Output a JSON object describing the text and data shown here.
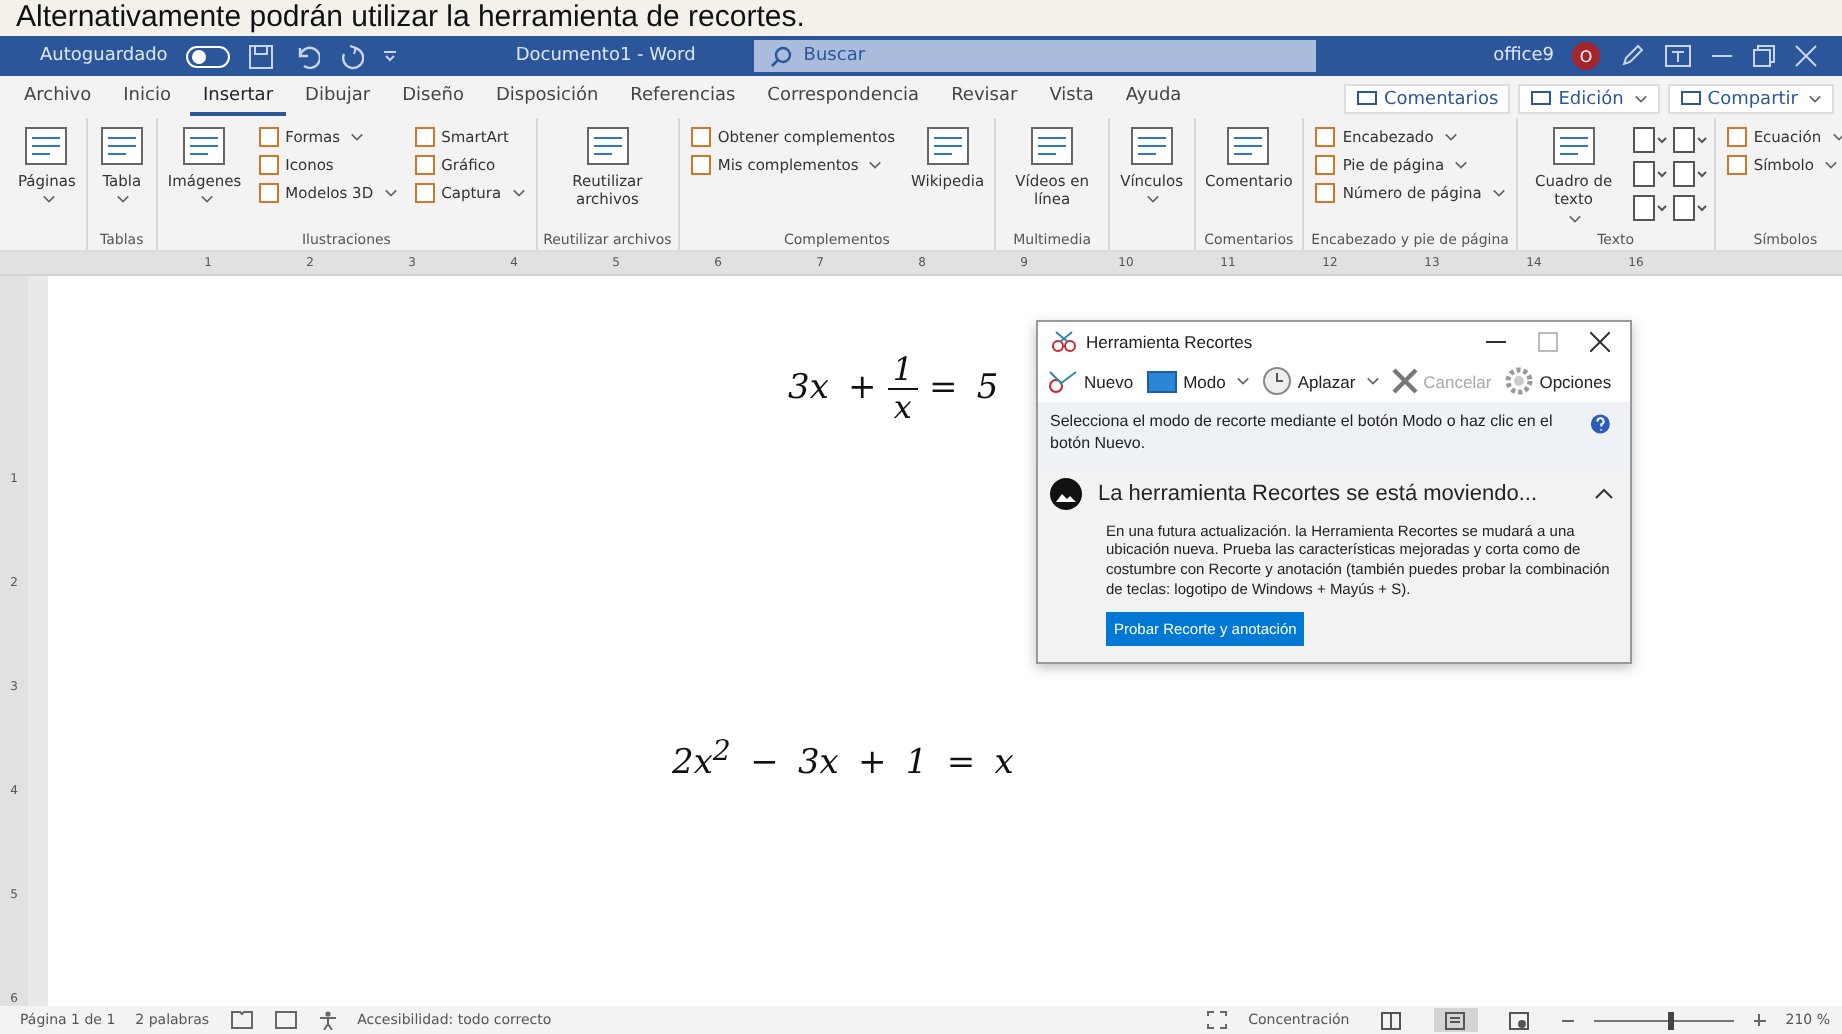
{
  "caption": "Alternativamente podrán utilizar la herramienta de recortes.",
  "title_bar": {
    "autosave_label": "Autoguardado",
    "autosave_on": false,
    "document_title": "Documento1 - Word",
    "search": {
      "placeholder": "Buscar"
    },
    "user": "office9",
    "avatar_initial": "O"
  },
  "tabs": [
    {
      "label": "Archivo",
      "selected": false
    },
    {
      "label": "Inicio",
      "selected": false
    },
    {
      "label": "Insertar",
      "selected": true
    },
    {
      "label": "Dibujar",
      "selected": false
    },
    {
      "label": "Diseño",
      "selected": false
    },
    {
      "label": "Disposición",
      "selected": false
    },
    {
      "label": "Referencias",
      "selected": false
    },
    {
      "label": "Correspondencia",
      "selected": false
    },
    {
      "label": "Revisar",
      "selected": false
    },
    {
      "label": "Vista",
      "selected": false
    },
    {
      "label": "Ayuda",
      "selected": false
    }
  ],
  "ribbon_actions": [
    {
      "label": "Comentarios",
      "caret": false
    },
    {
      "label": "Edición",
      "caret": true
    },
    {
      "label": "Compartir",
      "caret": true
    }
  ],
  "ribbon_groups": [
    {
      "items": [
        {
          "kind": "large",
          "label": "Páginas",
          "caret": true
        }
      ]
    },
    {
      "label": "Tablas",
      "items": [
        {
          "kind": "large",
          "label": "Tabla",
          "caret": true
        }
      ]
    },
    {
      "label": "Ilustraciones",
      "items": [
        {
          "kind": "large",
          "label": "Imágenes",
          "caret": true
        },
        {
          "kind": "column",
          "entries": [
            {
              "label": "Formas",
              "caret": true
            },
            {
              "label": "Iconos",
              "caret": false
            },
            {
              "label": "Modelos 3D",
              "caret": true
            }
          ]
        },
        {
          "kind": "column",
          "entries": [
            {
              "label": "SmartArt",
              "caret": false
            },
            {
              "label": "Gráfico",
              "caret": false
            },
            {
              "label": "Captura",
              "caret": true
            }
          ]
        }
      ]
    },
    {
      "label": "Reutilizar archivos",
      "items": [
        {
          "kind": "large",
          "label": "Reutilizar archivos",
          "caret": false
        }
      ]
    },
    {
      "label": "Complementos",
      "items": [
        {
          "kind": "column",
          "entries": [
            {
              "label": "Obtener complementos",
              "caret": false
            },
            {
              "label": "Mis complementos",
              "caret": true
            }
          ]
        },
        {
          "kind": "large",
          "label": "Wikipedia",
          "caret": false
        }
      ]
    },
    {
      "label": "Multimedia",
      "items": [
        {
          "kind": "large",
          "label": "Vídeos en línea",
          "caret": false
        }
      ]
    },
    {
      "items": [
        {
          "kind": "large",
          "label": "Vínculos",
          "caret": true
        }
      ]
    },
    {
      "label": "Comentarios",
      "items": [
        {
          "kind": "large",
          "label": "Comentario",
          "caret": false
        }
      ]
    },
    {
      "label": "Encabezado y pie de página",
      "items": [
        {
          "kind": "column",
          "entries": [
            {
              "label": "Encabezado",
              "caret": true
            },
            {
              "label": "Pie de página",
              "caret": true
            },
            {
              "label": "Número de página",
              "caret": true
            }
          ]
        }
      ]
    },
    {
      "label": "Texto",
      "items": [
        {
          "kind": "large",
          "label": "Cuadro de texto",
          "caret": true
        },
        {
          "kind": "icons"
        }
      ]
    },
    {
      "label": "Símbolos",
      "items": [
        {
          "kind": "column",
          "entries": [
            {
              "label": "Ecuación",
              "caret": true
            },
            {
              "label": "Símbolo",
              "caret": true
            }
          ]
        }
      ]
    }
  ],
  "ruler": {
    "marks": [
      "1",
      "2",
      "3",
      "4",
      "5",
      "6",
      "7",
      "8",
      "9",
      "10",
      "11",
      "12",
      "13",
      "14",
      "16"
    ]
  },
  "vertical_ruler": {
    "marks": [
      "1",
      "2",
      "3",
      "4",
      "5",
      "6"
    ]
  },
  "equations": [
    {
      "kind": "fraction",
      "before": "3x + ",
      "numerator": "1",
      "denominator": "x",
      "after": " = 5"
    },
    {
      "kind": "plain",
      "text": "2x$^{2}$ − 3x + 1 = x"
    }
  ],
  "snipping_tool": {
    "title": "Herramienta Recortes",
    "tools": [
      {
        "kind": "new",
        "label": "Nuevo",
        "caret": false,
        "disabled": false
      },
      {
        "kind": "mode",
        "label": "Modo",
        "caret": true,
        "disabled": false
      },
      {
        "kind": "delay",
        "label": "Aplazar",
        "caret": true,
        "disabled": false
      },
      {
        "kind": "cancel",
        "label": "Cancelar",
        "caret": false,
        "disabled": true
      },
      {
        "kind": "options",
        "label": "Opciones",
        "caret": false,
        "disabled": false
      }
    ],
    "hint": "Selecciona el modo de recorte mediante el botón Modo o haz clic en el botón Nuevo.",
    "notice": {
      "title": "La herramienta Recortes se está moviendo...",
      "expanded": true,
      "body": "En una futura actualización. la Herramienta Recortes se mudará a una ubicación nueva. Prueba las características mejoradas y corta como de costumbre con Recorte y anotación (también puedes probar la combinación de teclas: logotipo de Windows + Mayús + S).",
      "button": "Probar Recorte y anotación"
    }
  },
  "status_bar": {
    "page": "Página 1 de 1",
    "words": "2 palabras",
    "accessibility": "Accesibilidad: todo correcto",
    "focus": "Concentración",
    "views": [
      {
        "kind": "read",
        "selected": false
      },
      {
        "kind": "print",
        "selected": true
      },
      {
        "kind": "web",
        "selected": false
      }
    ],
    "zoom_slider": {
      "level": 0.55
    },
    "zoom": "210 %"
  }
}
